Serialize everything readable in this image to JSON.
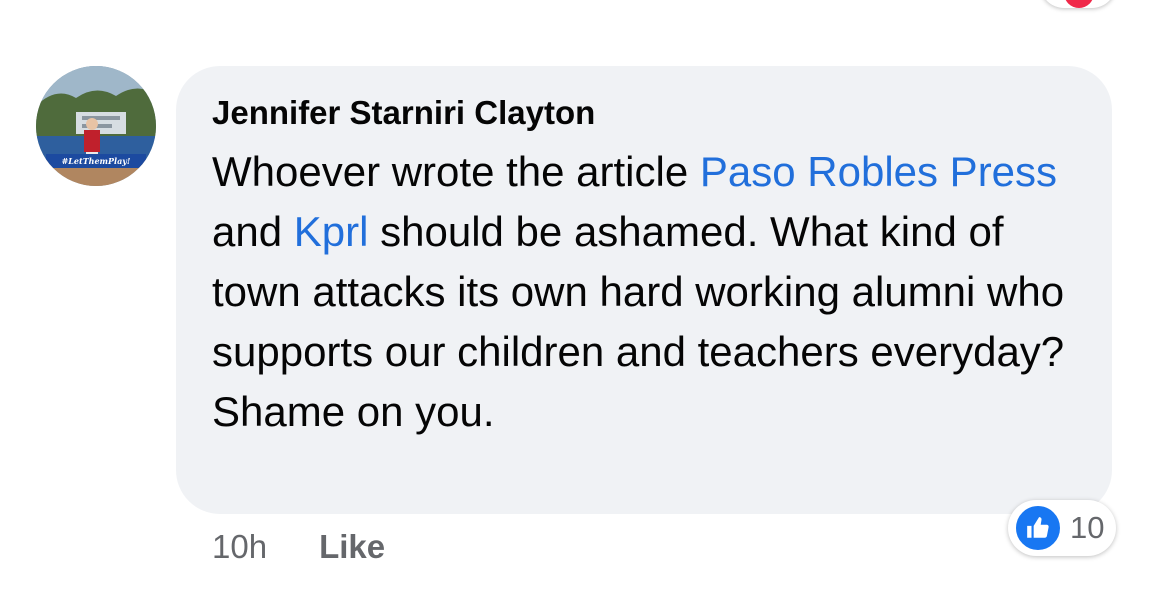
{
  "comment": {
    "author": "Jennifer Starniri Clayton",
    "segments": [
      {
        "text": "Whoever wrote the article ",
        "link": false
      },
      {
        "text": "Paso Robles Press",
        "link": true
      },
      {
        "text": " and ",
        "link": false
      },
      {
        "text": "Kprl",
        "link": true
      },
      {
        "text": " should be ashamed. What kind of town attacks its own hard working alumni who supports our children and teachers everyday? Shame on you.",
        "link": false
      }
    ],
    "time": "10h",
    "like_label": "Like",
    "reaction_icon": "thumbs-up-icon",
    "reaction_count": "10",
    "avatar_caption": "#LetThemPlay!"
  },
  "colors": {
    "link": "#216fdb",
    "bubble": "#f0f2f5",
    "meta": "#65676b",
    "like_blue": "#1877f2"
  }
}
